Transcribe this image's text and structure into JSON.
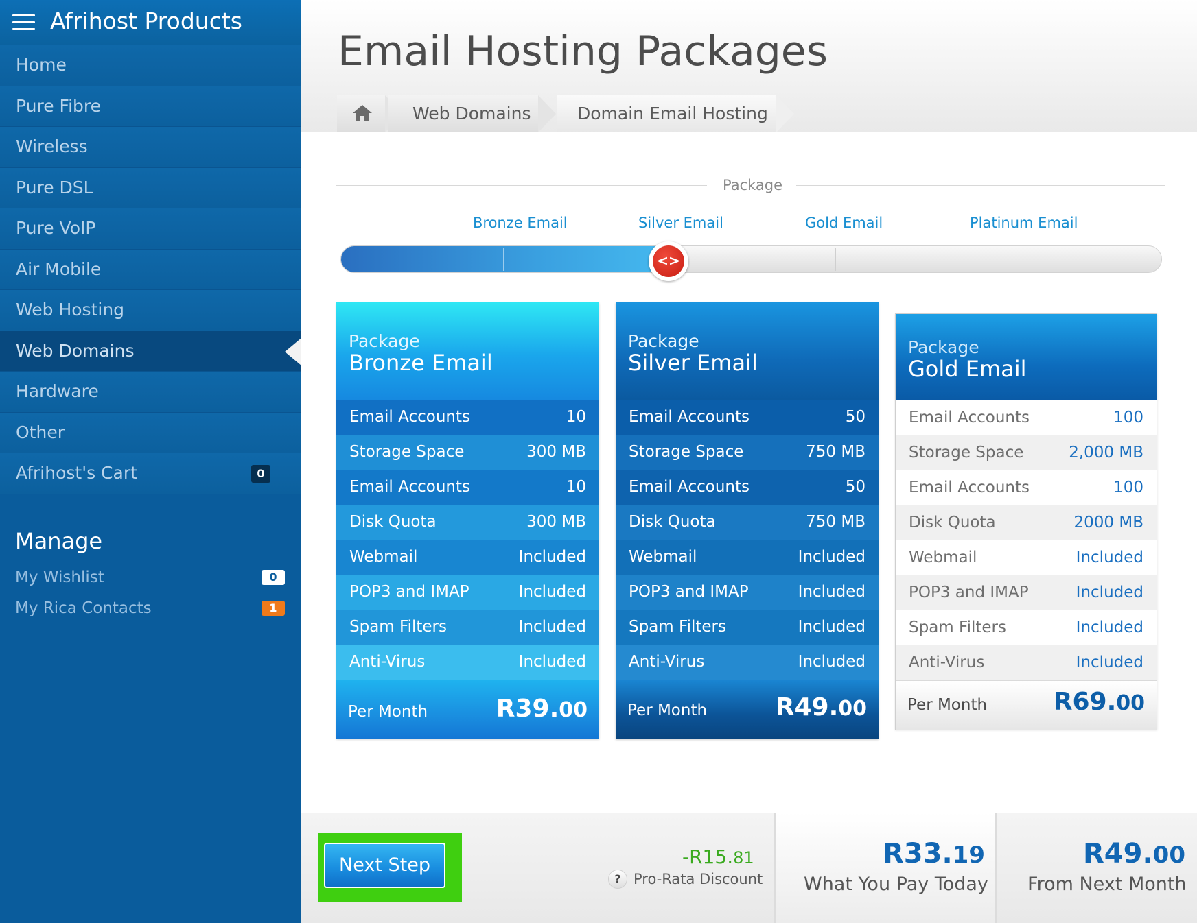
{
  "sidebar": {
    "title": "Afrihost Products",
    "items": [
      {
        "label": "Home"
      },
      {
        "label": "Pure Fibre"
      },
      {
        "label": "Wireless"
      },
      {
        "label": "Pure DSL"
      },
      {
        "label": "Pure VoIP"
      },
      {
        "label": "Air Mobile"
      },
      {
        "label": "Web Hosting"
      },
      {
        "label": "Web Domains",
        "active": true
      },
      {
        "label": "Hardware"
      },
      {
        "label": "Other"
      },
      {
        "label": "Afrihost's Cart",
        "badge": "0"
      }
    ],
    "manage": {
      "title": "Manage",
      "wishlist": {
        "label": "My Wishlist",
        "badge": "0"
      },
      "rica": {
        "label": "My Rica Contacts",
        "badge": "1"
      }
    }
  },
  "header": {
    "title": "Email Hosting Packages",
    "breadcrumb": [
      "Web Domains",
      "Domain Email Hosting"
    ]
  },
  "package_selector": {
    "label": "Package",
    "steps": [
      "Bronze Email",
      "Silver Email",
      "Gold Email",
      "Platinum Email"
    ],
    "selected": "Silver Email",
    "knob_glyph": "<>"
  },
  "cards": [
    {
      "pkg_label": "Package",
      "name": "Bronze Email",
      "rows": [
        {
          "k": "Email Accounts",
          "v": "10"
        },
        {
          "k": "Storage Space",
          "v": "300 MB"
        },
        {
          "k": "Email Accounts",
          "v": "10"
        },
        {
          "k": "Disk Quota",
          "v": "300 MB"
        },
        {
          "k": "Webmail",
          "v": "Included"
        },
        {
          "k": "POP3 and IMAP",
          "v": "Included"
        },
        {
          "k": "Spam Filters",
          "v": "Included"
        },
        {
          "k": "Anti-Virus",
          "v": "Included"
        }
      ],
      "per_month_label": "Per Month",
      "price_main": "R39.",
      "price_cents": "00"
    },
    {
      "pkg_label": "Package",
      "name": "Silver Email",
      "rows": [
        {
          "k": "Email Accounts",
          "v": "50"
        },
        {
          "k": "Storage Space",
          "v": "750 MB"
        },
        {
          "k": "Email Accounts",
          "v": "50"
        },
        {
          "k": "Disk Quota",
          "v": "750 MB"
        },
        {
          "k": "Webmail",
          "v": "Included"
        },
        {
          "k": "POP3 and IMAP",
          "v": "Included"
        },
        {
          "k": "Spam Filters",
          "v": "Included"
        },
        {
          "k": "Anti-Virus",
          "v": "Included"
        }
      ],
      "per_month_label": "Per Month",
      "price_main": "R49.",
      "price_cents": "00"
    },
    {
      "pkg_label": "Package",
      "name": "Gold Email",
      "rows": [
        {
          "k": "Email Accounts",
          "v": "100"
        },
        {
          "k": "Storage Space",
          "v": "2,000 MB"
        },
        {
          "k": "Email Accounts",
          "v": "100"
        },
        {
          "k": "Disk Quota",
          "v": "2000 MB"
        },
        {
          "k": "Webmail",
          "v": "Included"
        },
        {
          "k": "POP3 and IMAP",
          "v": "Included"
        },
        {
          "k": "Spam Filters",
          "v": "Included"
        },
        {
          "k": "Anti-Virus",
          "v": "Included"
        }
      ],
      "per_month_label": "Per Month",
      "price_main": "R69.",
      "price_cents": "00"
    }
  ],
  "footer": {
    "next_button": "Next Step",
    "discount_main": "-R15.",
    "discount_cents": "81",
    "help_glyph": "?",
    "discount_label": "Pro-Rata Discount",
    "today_main": "R33.",
    "today_cents": "19",
    "today_label": "What You Pay Today",
    "next_month_main": "R49.",
    "next_month_cents": "00",
    "next_month_label": "From Next Month"
  },
  "colors": {
    "sidebar_bg": "#0a5c9c",
    "accent_blue": "#1a8fd1",
    "highlight_green": "#3fcf10",
    "discount_green": "#3aaa1f",
    "knob_red": "#c81d12"
  },
  "icons": [
    "menu-icon",
    "home-icon",
    "slider-arrows-icon",
    "help-icon"
  ]
}
